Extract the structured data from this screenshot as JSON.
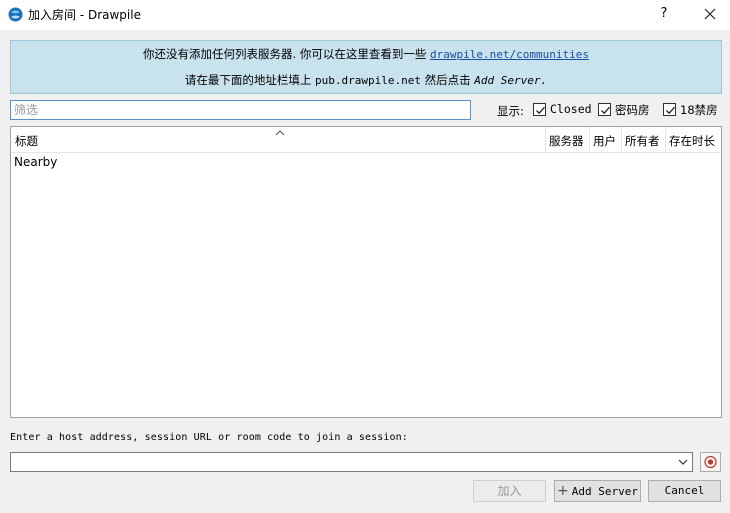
{
  "window": {
    "title": "加入房间 - Drawpile",
    "help_label": "?"
  },
  "info": {
    "line1_prefix": "你还没有添加任何列表服务器.",
    "line1_middle": " 你可以在这里查看到一些 ",
    "line1_link": "drawpile.net/communities",
    "line2_prefix": "请在最下面的地址栏填上 ",
    "line2_address": "pub.drawpile.net",
    "line2_middle": " 然后点击 ",
    "line2_action": "Add Server."
  },
  "filter": {
    "placeholder": "筛选",
    "value": ""
  },
  "show": {
    "label": "显示:",
    "checkboxes": [
      {
        "label": "Closed",
        "checked": true
      },
      {
        "label": "密码房",
        "checked": true
      },
      {
        "label": "18禁房",
        "checked": true
      }
    ]
  },
  "table": {
    "columns": [
      "标题",
      "服务器",
      "用户",
      "所有者",
      "存在时长"
    ],
    "rows": [
      {
        "title": "Nearby"
      }
    ]
  },
  "host": {
    "label": "Enter a host address, session URL or room code to join a session:",
    "value": ""
  },
  "buttons": {
    "join": "加入",
    "add_server": "Add Server",
    "cancel": "Cancel"
  },
  "colors": {
    "info_background": "#c8e2ee",
    "link": "#1a4fa0",
    "record_icon": "#c0392b"
  }
}
